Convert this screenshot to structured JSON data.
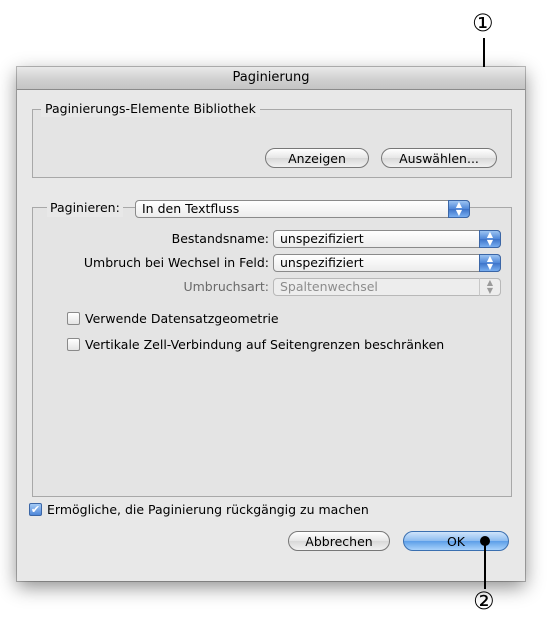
{
  "callouts": {
    "one": "①",
    "two": "②"
  },
  "dialog": {
    "title": "Paginierung",
    "library": {
      "legend": "Paginierungs-Elemente Bibliothek",
      "show_button": "Anzeigen",
      "select_button": "Auswählen..."
    },
    "paginate": {
      "label": "Paginieren:",
      "value": "In den Textfluss",
      "fields": [
        {
          "label": "Bestandsname:",
          "value": "unspezifiziert",
          "enabled": true
        },
        {
          "label": "Umbruch bei Wechsel in Feld:",
          "value": "unspezifiziert",
          "enabled": true
        },
        {
          "label": "Umbruchsart:",
          "value": "Spaltenwechsel",
          "enabled": false
        }
      ],
      "checkboxes": [
        {
          "label": "Verwende Datensatzgeometrie",
          "checked": false
        },
        {
          "label": "Vertikale Zell-Verbindung auf Seitengrenzen beschränken",
          "checked": false
        }
      ]
    },
    "undo_checkbox": {
      "label": "Ermögliche, die Paginierung rückgängig zu machen",
      "checked": true
    },
    "cancel_button": "Abbrechen",
    "ok_button": "OK"
  },
  "icons": {
    "popup_arrows": "updown-arrows-icon",
    "checkmark": "checkmark-icon"
  },
  "colors": {
    "accent": "#4e86d8",
    "window_bg": "#e8e8e8"
  }
}
